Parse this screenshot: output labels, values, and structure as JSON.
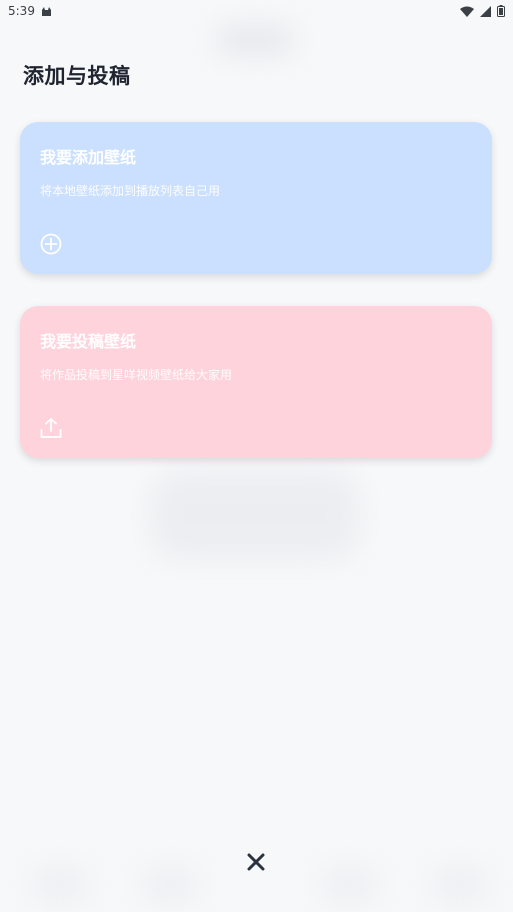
{
  "status_bar": {
    "time": "5:39"
  },
  "page": {
    "title": "添加与投稿"
  },
  "cards": {
    "add": {
      "title": "我要添加壁纸",
      "description": "将本地壁纸添加到播放列表自己用",
      "icon": "plus-circle-icon",
      "color": "#cbdffe"
    },
    "submit": {
      "title": "我要投稿壁纸",
      "description": "将作品投稿到星咩视频壁纸给大家用",
      "icon": "upload-icon",
      "color": "#ffd3dc"
    }
  },
  "close": {
    "icon": "close-icon",
    "color": "#2b3340"
  }
}
